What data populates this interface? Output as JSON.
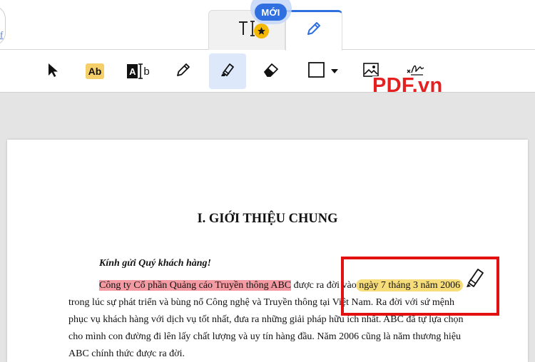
{
  "tabs": {
    "new_badge": "MỚI",
    "text_tab_name": "text-edit-tab",
    "edit_tab_name": "annotate-tab"
  },
  "edge": {
    "link_text": "f"
  },
  "toolbar": {
    "tools": [
      {
        "name": "select-tool",
        "icon": "cursor-arrow-icon"
      },
      {
        "name": "highlight-text-tool",
        "icon": "ab-highlight-icon",
        "label": "Ab"
      },
      {
        "name": "text-replace-tool",
        "icon": "text-cursor-ab-icon",
        "label": "A",
        "label2": "b"
      },
      {
        "name": "draw-tool",
        "icon": "pencil-icon"
      },
      {
        "name": "highlighter-tool",
        "icon": "highlighter-icon",
        "active": true
      },
      {
        "name": "eraser-tool",
        "icon": "eraser-icon"
      },
      {
        "name": "shape-tool",
        "icon": "rectangle-icon"
      },
      {
        "name": "image-tool",
        "icon": "image-icon"
      },
      {
        "name": "signature-tool",
        "icon": "signature-icon"
      }
    ]
  },
  "brand": {
    "text": "PDF.vn",
    "color": "#e52020"
  },
  "document": {
    "heading": "I. GIỚI THIỆU CHUNG",
    "greeting": "Kính gửi Quý khách hàng!",
    "line1_highlight_red": "Công ty Cổ phần Quảng cáo Truyền thông ABC",
    "line1_middle": " được ra đời vào ",
    "line1_highlight_yellow": "ngày 7 tháng 3 năm 2006",
    "line2": "trong lúc sự phát triển và bùng nổ Công nghệ và Truyền thông tại Việt Nam. Ra đời với sứ mệnh",
    "line3": "phục vụ khách hàng với dịch vụ tốt nhất, đưa ra những giải pháp hữu ích nhất. ABC đã tự lựa chọn",
    "line4": "cho mình con đường đi lên lấy chất lượng và uy tín hàng đầu. Năm 2006 cũng là năm thương hiệu",
    "line5": "ABC chính thức được ra đời."
  },
  "colors": {
    "accent": "#2f6fe0",
    "highlight_red": "#f39aa2",
    "highlight_yellow": "#f7dd7a",
    "callout_border": "#e31010"
  }
}
